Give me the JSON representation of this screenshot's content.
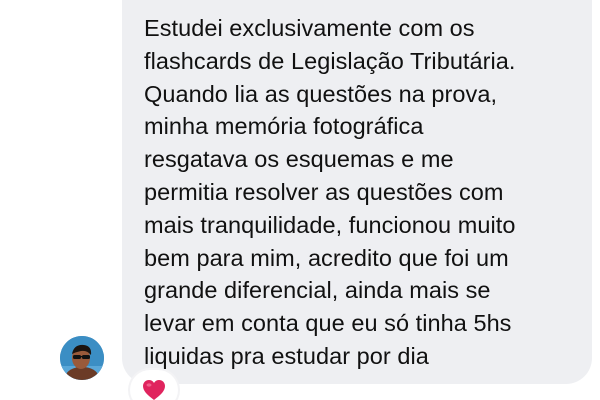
{
  "message": {
    "lines": [
      "Estudei exclusivamente com os",
      "flashcards de Legislação Tributária.",
      "Quando lia as questões na prova,",
      "minha memória fotográfica",
      "resgatava os esquemas e me",
      "permitia resolver as questões com",
      "mais tranquilidade, funcionou muito",
      "bem para mim, acredito que foi um",
      "grande diferencial, ainda mais se",
      "levar em conta que eu só tinha 5hs",
      "liquidas pra estudar por dia"
    ]
  },
  "sender": {
    "avatar_icon": "profile-photo"
  },
  "reaction": {
    "icon": "red-heart-icon",
    "color": "#e0245e"
  },
  "colors": {
    "bubble": "#eeeff2",
    "text": "#111111"
  }
}
